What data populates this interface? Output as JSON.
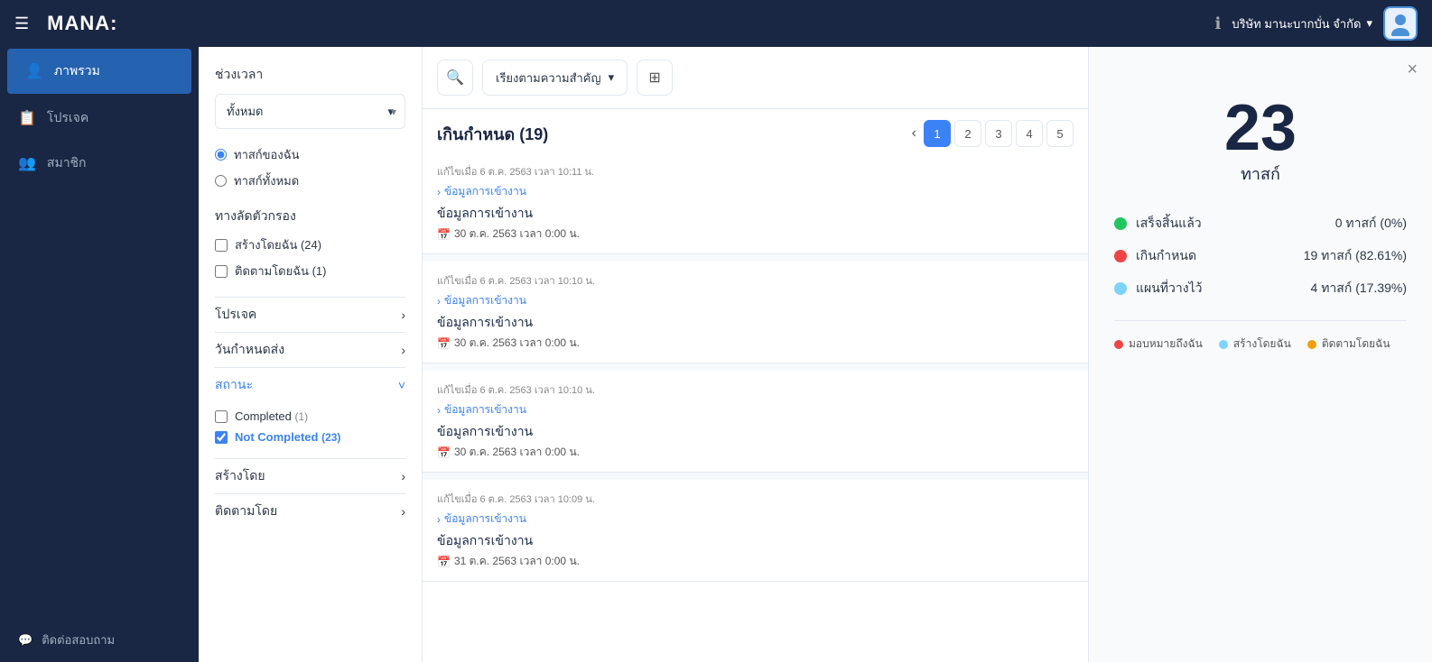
{
  "topnav": {
    "logo": "MANA:",
    "company": "บริษัท มานะบากบั่น จำกัด",
    "info_icon": "ℹ"
  },
  "sidebar": {
    "items": [
      {
        "label": "ภาพรวม",
        "icon": "👤",
        "active": true
      },
      {
        "label": "โปรเจค",
        "icon": "📋",
        "active": false
      },
      {
        "label": "สมาชิก",
        "icon": "👥",
        "active": false
      }
    ],
    "footer": {
      "label": "ติดต่อสอบถาม",
      "icon": "💬"
    }
  },
  "filter": {
    "time_label": "ช่วงเวลา",
    "time_value": "ทั้งหมด",
    "task_options": {
      "my_task": "ทาสก์ของฉัน",
      "all_task": "ทาสก์ทั้งหมด"
    },
    "shortcut_label": "ทางลัดตัวกรอง",
    "shortcuts": [
      {
        "label": "สร้างโดยฉัน (24)",
        "checked": false
      },
      {
        "label": "ติดตามโดยฉัน (1)",
        "checked": false
      }
    ],
    "project_label": "โปรเจค",
    "deadline_label": "วันกำหนดส่ง",
    "status_label": "สถานะ",
    "status_open": true,
    "statuses": [
      {
        "label": "Completed",
        "count": "(1)",
        "checked": false,
        "id": "completed"
      },
      {
        "label": "Not Completed",
        "count": "(23)",
        "checked": true,
        "id": "not-completed"
      }
    ],
    "created_by_label": "สร้างโดย",
    "followed_by_label": "ติดตามโดย"
  },
  "tasklist": {
    "title": "เกินกำหนด (19)",
    "pagination": {
      "current": 1,
      "pages": [
        1,
        2,
        3,
        4,
        5
      ]
    },
    "sort_label": "เรียงตามความสำคัญ",
    "tasks": [
      {
        "parent": "ข้อมูลการเข้างาน",
        "name": "ข้อมูลการเข้างาน",
        "modified": "แก้ไขเมื่อ 6 ต.ค. 2563 เวลา 10:11 น.",
        "due": "30 ต.ค. 2563 เวลา 0:00 น."
      },
      {
        "parent": "ข้อมูลการเข้างาน",
        "name": "ข้อมูลการเข้างาน",
        "modified": "แก้ไขเมื่อ 6 ต.ค. 2563 เวลา 10:10 น.",
        "due": "30 ต.ค. 2563 เวลา 0:00 น."
      },
      {
        "parent": "ข้อมูลการเข้างาน",
        "name": "ข้อมูลการเข้างาน",
        "modified": "แก้ไขเมื่อ 6 ต.ค. 2563 เวลา 10:10 น.",
        "due": "30 ต.ค. 2563 เวลา 0:00 น."
      },
      {
        "parent": "ข้อมูลการเข้างาน",
        "name": "ข้อมูลการเข้างาน",
        "modified": "แก้ไขเมื่อ 6 ต.ค. 2563 เวลา 10:09 น.",
        "due": "31 ต.ค. 2563 เวลา 0:00 น."
      }
    ]
  },
  "stats": {
    "total": "23",
    "unit": "ทาสก์",
    "close_label": "×",
    "rows": [
      {
        "label": "เสร็จสิ้นแล้ว",
        "value": "0 ทาสก์ (0%)",
        "color": "green"
      },
      {
        "label": "เกินกำหนด",
        "value": "19 ทาสก์ (82.61%)",
        "color": "red"
      },
      {
        "label": "แผนที่วางไว้",
        "value": "4 ทาสก์ (17.39%)",
        "color": "blue"
      }
    ],
    "legend": [
      {
        "label": "มอบหมายถึงฉัน",
        "color": "red"
      },
      {
        "label": "สร้างโดยฉัน",
        "color": "sky"
      },
      {
        "label": "ติดตามโดยฉัน",
        "color": "orange"
      }
    ]
  }
}
